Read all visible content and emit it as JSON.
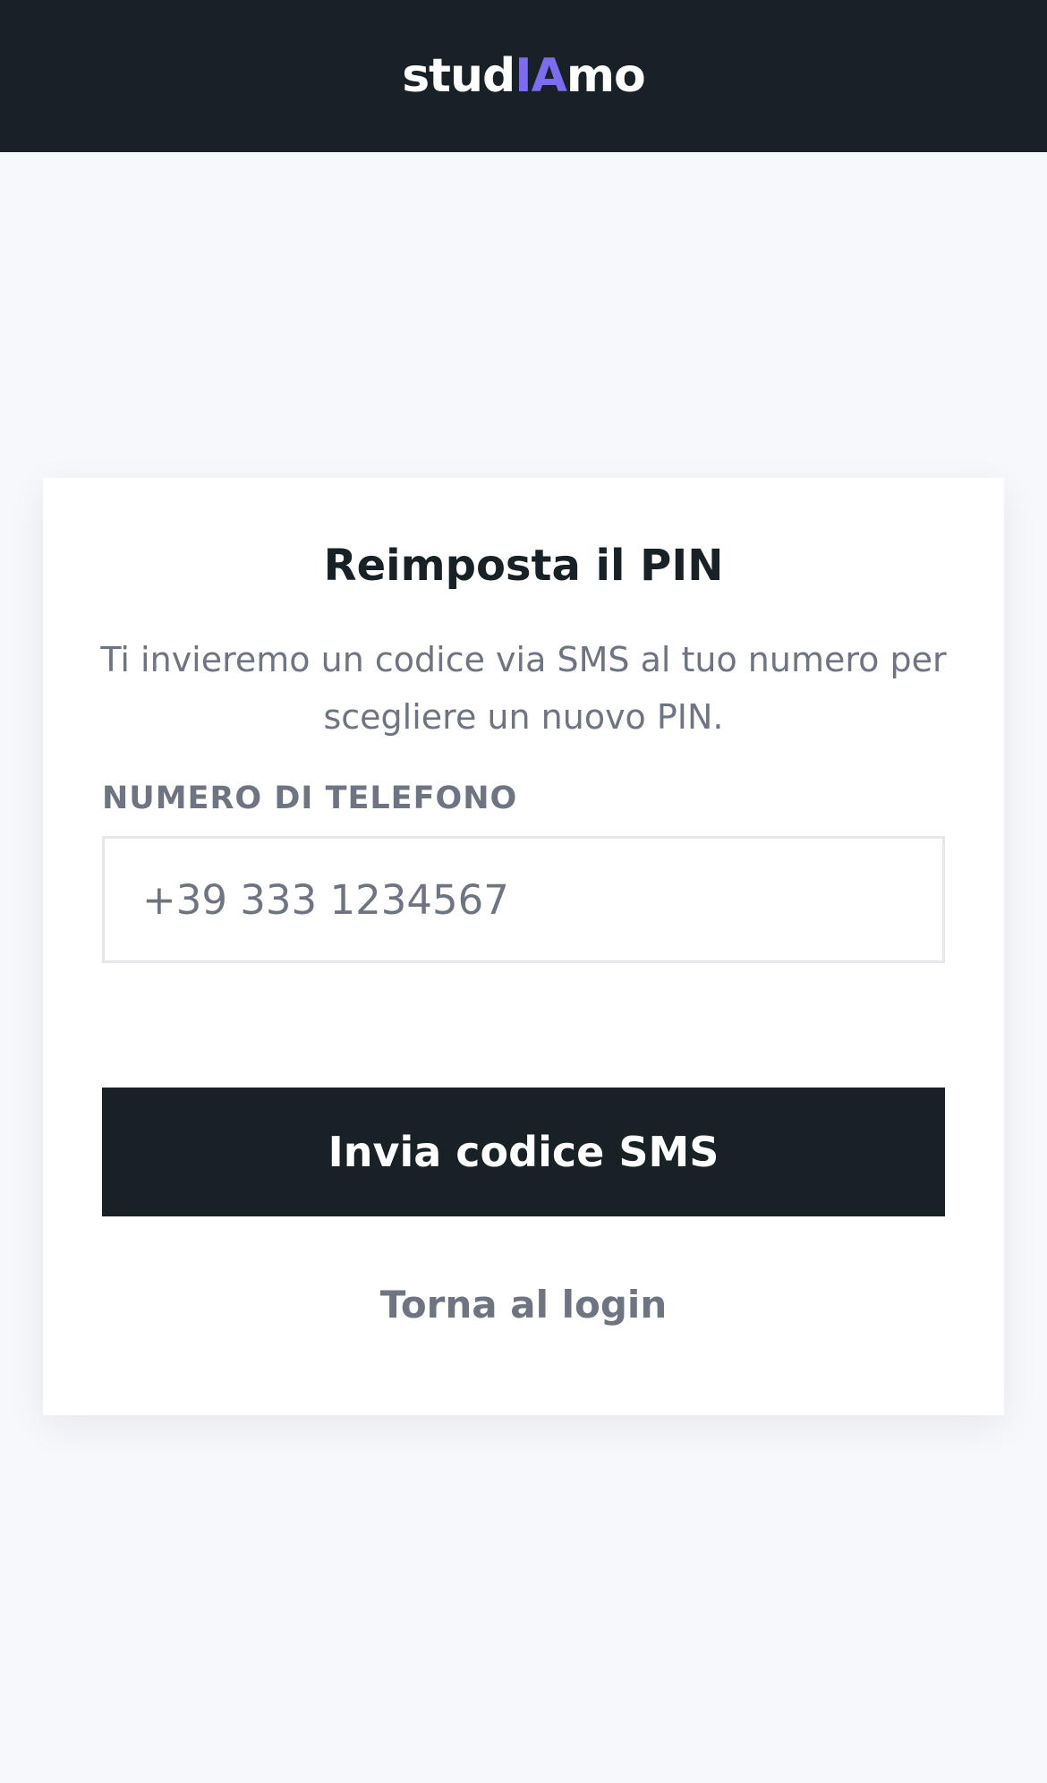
{
  "header": {
    "logo_prefix": "stud",
    "logo_accent": "IA",
    "logo_suffix": "mo",
    "background_color": "#182126",
    "accent_color": "#7b6cf0"
  },
  "reset_pin": {
    "title": "Reimposta il PIN",
    "description": "Ti invieremo un codice via SMS al tuo numero per scegliere un nuovo PIN.",
    "phone_label": "NUMERO DI TELEFONO",
    "phone_placeholder": "+39 333 1234567",
    "phone_value": "",
    "submit_label": "Invia codice SMS",
    "back_label": "Torna al login"
  },
  "colors": {
    "page_background": "#f7f8fc",
    "card_background": "#ffffff",
    "primary_button": "#182126",
    "muted_text": "#6f7482"
  }
}
